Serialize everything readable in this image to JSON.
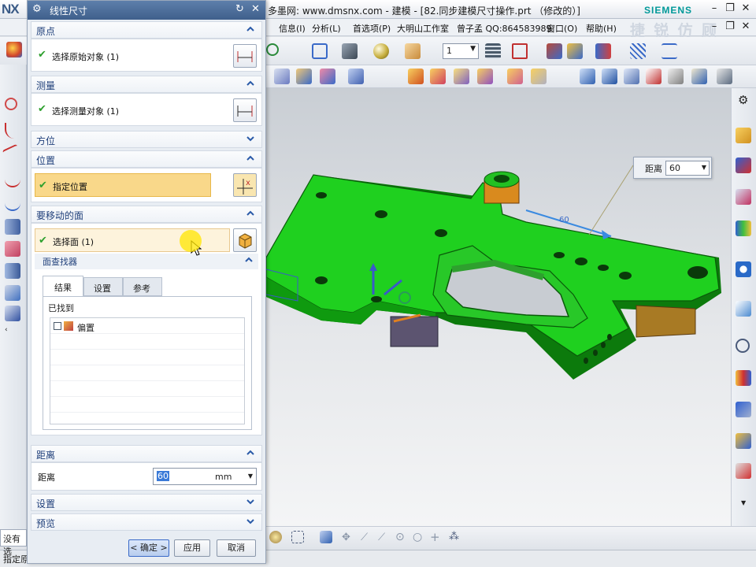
{
  "app": {
    "logo": "NX",
    "title": "多墨网: www.dmsnx.com - 建模 - [82.同步建模尺寸操作.prt （修改的）]",
    "brand": "SIEMENS",
    "watermark": "捷 锐 仿 顾"
  },
  "menu": {
    "items": [
      "信息(I)",
      "分析(L)",
      "首选项(P)",
      "大明山工作室",
      "曾子孟 QQ:864583989",
      "窗口(O)",
      "帮助(H)"
    ]
  },
  "toolbar": {
    "layer_value": "1"
  },
  "dialog": {
    "title": "线性尺寸",
    "sections": {
      "origin": {
        "header": "原点",
        "row": "选择原始对象 (1)"
      },
      "measure": {
        "header": "测量",
        "row": "选择测量对象 (1)"
      },
      "orientation": {
        "header": "方位"
      },
      "location": {
        "header": "位置",
        "row": "指定位置"
      },
      "faces": {
        "header": "要移动的面",
        "row": "选择面 (1)"
      },
      "finder": {
        "header": "面查找器",
        "tabs": [
          "结果",
          "设置",
          "参考"
        ],
        "found_label": "已找到",
        "tree_item": "偏置"
      },
      "distance": {
        "header": "距离",
        "label": "距离",
        "value": "60",
        "unit": "mm"
      },
      "settings": {
        "header": "设置"
      },
      "preview": {
        "header": "预览"
      }
    },
    "buttons": {
      "ok": "< 确定 >",
      "apply": "应用",
      "cancel": "取消"
    }
  },
  "floating_distance": {
    "label": "距离",
    "value": "60"
  },
  "status": {
    "left_hint": "没有选",
    "bottom_text": "指定原"
  },
  "colors": {
    "part_green": "#1fd01f",
    "part_edge": "#0a5a0a",
    "boss_orange": "#d98a1e",
    "face_brown": "#a87a24",
    "face_purple": "#5c5470",
    "highlight_row": "#f9d88a",
    "dialog_title": "#4a6b98"
  }
}
